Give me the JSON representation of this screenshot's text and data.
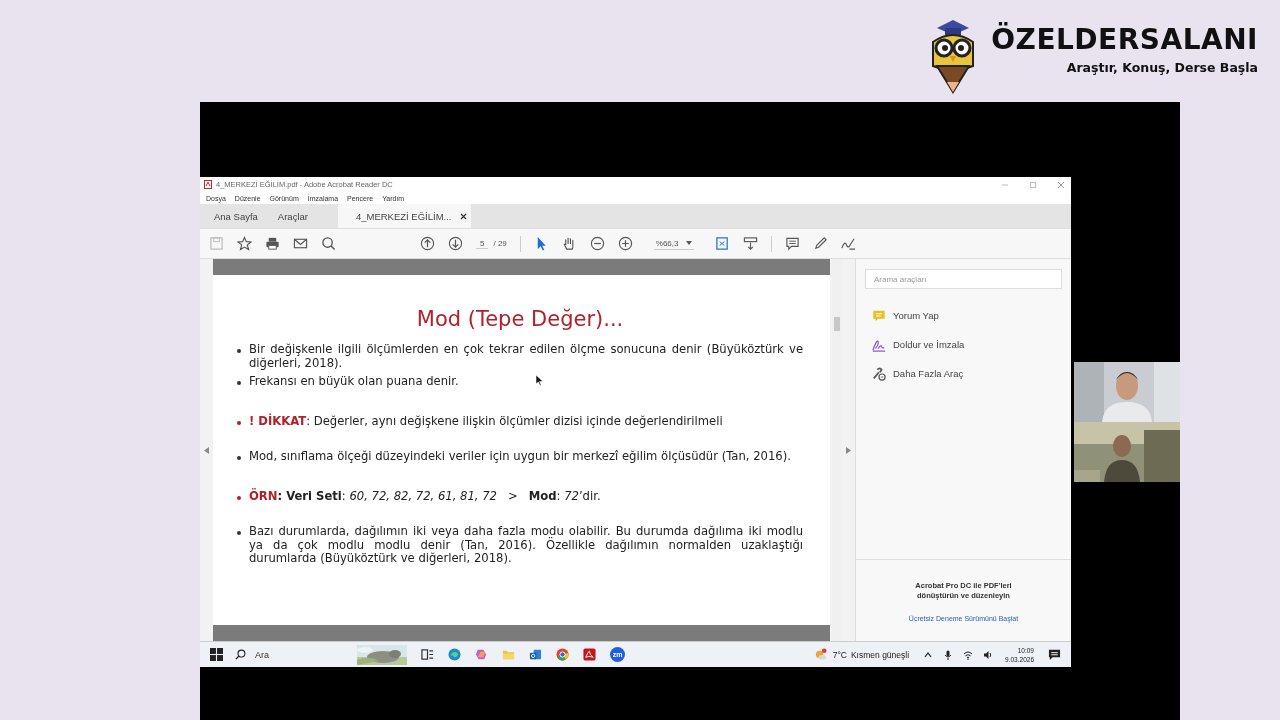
{
  "brand": {
    "name": "ÖZELDERSALANI",
    "tagline": "Araştır, Konuş, Derse Başla"
  },
  "window": {
    "title": "4_MERKEZİ EĞİLİM.pdf - Adobe Acrobat Reader DC"
  },
  "menu": [
    "Dosya",
    "Düzenle",
    "Görünüm",
    "İmzalama",
    "Pencere",
    "Yardım"
  ],
  "tabs": [
    {
      "label": "Ana Sayfa",
      "selected": false,
      "closable": false
    },
    {
      "label": "Araçlar",
      "selected": false,
      "closable": false
    },
    {
      "label": "4_MERKEZİ EĞİLİM...",
      "selected": true,
      "closable": true
    }
  ],
  "toolbar": {
    "page": "5",
    "page_count": "/ 29",
    "zoom": "%66,3"
  },
  "slide": {
    "title": "Mod (Tepe Değer)...",
    "bullets": [
      {
        "text": "Bir değişkenle ilgili ölçümlerden en çok tekrar edilen ölçme sonucuna denir (Büyüköztürk ve diğerleri, 2018)."
      },
      {
        "text": "Frekansı en büyük olan puana denir."
      },
      {
        "lead": "! DİKKAT",
        "text": ": Değerler, aynı değişkene ilişkin ölçümler dizisi içinde değerlendirilmeli"
      },
      {
        "text": "Mod, sınıflama ölçeği düzeyindeki veriler için uygun bir merkezî eğilim ölçüsüdür (Tan, 2016)."
      },
      {
        "lead": "ÖRN",
        "text": "**: Veri Seti**: *60, 72, 82, 72, 61, 81, 72*   >   **Mod**: *72*’dir."
      },
      {
        "text": "Bazı durumlarda, dağılımın iki veya daha fazla modu olabilir. Bu durumda dağılıma iki modlu ya da çok modlu modlu denir (Tan, 2016). Özellikle dağılımın normalden uzaklaştığı durumlarda (Büyüköztürk ve diğerleri, 2018)."
      }
    ]
  },
  "tools_panel": {
    "search": {
      "placeholder": "Arama araçları"
    },
    "tools": [
      {
        "kind": "comment",
        "label": "Yorum Yap"
      },
      {
        "kind": "fill-sign",
        "label": "Doldur ve İmzala"
      },
      {
        "kind": "more",
        "label": "Daha Fazla Araç"
      }
    ],
    "promo": {
      "text": "Acrobat Pro DC ile PDF'leri dönüştürün ve düzenleyin",
      "link": "Ücretsiz Deneme Sürümünü Başlat"
    }
  },
  "taskbar": {
    "search": "Ara",
    "apps": [
      {
        "kind": "taskview"
      },
      {
        "kind": "edge"
      },
      {
        "kind": "copilot"
      },
      {
        "kind": "folder"
      },
      {
        "kind": "outlook"
      },
      {
        "kind": "chrome"
      },
      {
        "kind": "acrobat"
      },
      {
        "kind": "zoom",
        "label": "zm"
      }
    ],
    "weather": {
      "temp": "7°C",
      "condition": "Kısmen güneşli"
    },
    "time": "10:09",
    "date": "9.03.2026"
  }
}
